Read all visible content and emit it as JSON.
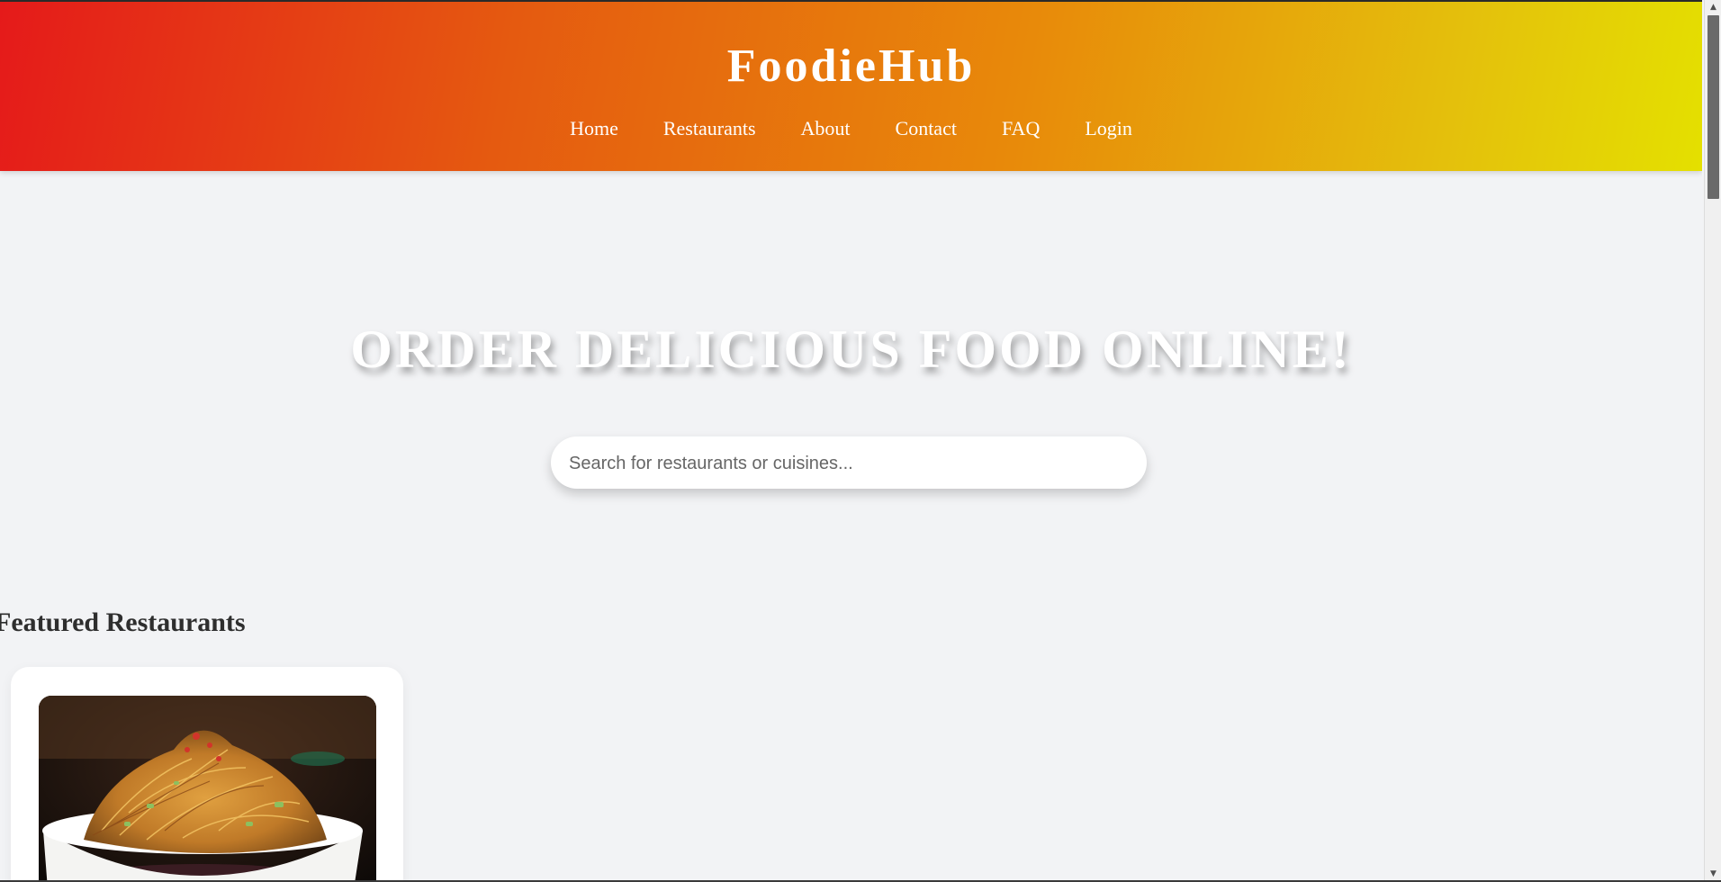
{
  "header": {
    "brand": "FoodieHub",
    "nav": [
      "Home",
      "Restaurants",
      "About",
      "Contact",
      "FAQ",
      "Login"
    ]
  },
  "hero": {
    "title": "ORDER DELICIOUS FOOD ONLINE!",
    "search_placeholder": "Search for restaurants or cuisines...",
    "search_value": ""
  },
  "featured": {
    "title": "Featured Restaurants",
    "cards": [
      {
        "image": "noodle-dish-photo"
      }
    ]
  },
  "colors": {
    "header_gradient": [
      "#e51a1a",
      "#e55a10",
      "#e88a0a",
      "#e4c00c",
      "#e4e000"
    ],
    "page_background": "#f2f3f5",
    "heading_text": "#2e2e2e"
  }
}
